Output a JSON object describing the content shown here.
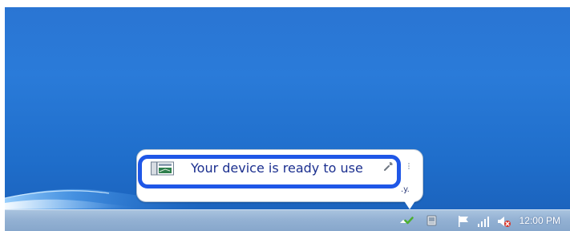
{
  "notification": {
    "message": "Your device is ready to use",
    "trailing_text": ".y."
  },
  "taskbar": {
    "clock": "12:00 PM"
  },
  "icons": {
    "balloon_device": "device-icon",
    "wrench": "wrench-icon",
    "show_hidden": "chevron-up-icon",
    "tray_device": "device-icon",
    "flag": "action-center-flag-icon",
    "network": "network-icon",
    "volume": "volume-muted-icon",
    "check": "check-icon"
  },
  "colors": {
    "desktop": "#2a75d3",
    "taskbar": "#93b1d3",
    "balloon_text": "#1b2f8f",
    "highlight": "#1f57e7",
    "check": "#4caf2f"
  }
}
